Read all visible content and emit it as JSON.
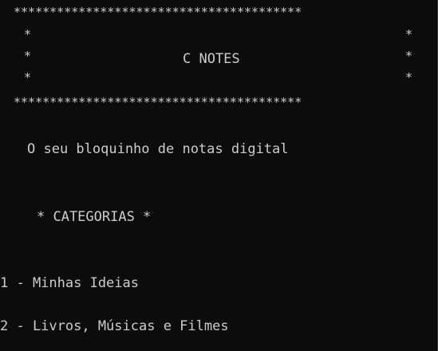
{
  "banner": {
    "border": "****************************************",
    "side_star": "*",
    "title": "C NOTES"
  },
  "subtitle": "O seu bloquinho de notas digital",
  "categories": {
    "heading": "* CATEGORIAS *",
    "items": [
      "1 - Minhas Ideias",
      "2 - Livros, Músicas e Filmes"
    ]
  },
  "colors": {
    "background": "#0c0c0c",
    "text": "#cccccc"
  }
}
